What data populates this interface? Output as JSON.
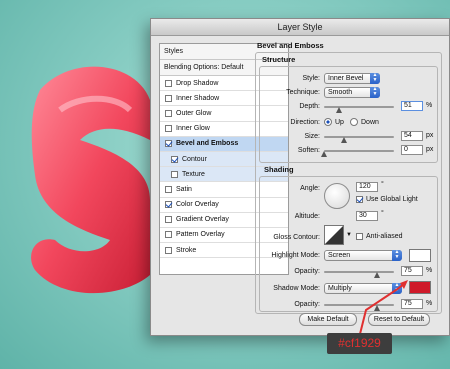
{
  "window": {
    "title": "Layer Style"
  },
  "left_panel": {
    "styles_label": "Styles",
    "blending_label": "Blending Options: Default",
    "items": [
      {
        "label": "Drop Shadow",
        "checked": false
      },
      {
        "label": "Inner Shadow",
        "checked": false
      },
      {
        "label": "Outer Glow",
        "checked": false
      },
      {
        "label": "Inner Glow",
        "checked": false
      },
      {
        "label": "Bevel and Emboss",
        "checked": true
      },
      {
        "label": "Contour",
        "checked": true
      },
      {
        "label": "Texture",
        "checked": false
      },
      {
        "label": "Satin",
        "checked": false
      },
      {
        "label": "Color Overlay",
        "checked": true
      },
      {
        "label": "Gradient Overlay",
        "checked": false
      },
      {
        "label": "Pattern Overlay",
        "checked": false
      },
      {
        "label": "Stroke",
        "checked": false
      }
    ]
  },
  "bevel": {
    "title": "Bevel and Emboss",
    "structure": {
      "title": "Structure",
      "style_label": "Style:",
      "style_value": "Inner Bevel",
      "technique_label": "Technique:",
      "technique_value": "Smooth",
      "depth_label": "Depth:",
      "depth_value": "51",
      "depth_unit": "%",
      "direction_label": "Direction:",
      "dir_up": "Up",
      "dir_down": "Down",
      "size_label": "Size:",
      "size_value": "54",
      "size_unit": "px",
      "soften_label": "Soften:",
      "soften_value": "0",
      "soften_unit": "px"
    },
    "shading": {
      "title": "Shading",
      "angle_label": "Angle:",
      "angle_value": "120",
      "degree": "°",
      "global_light_label": "Use Global Light",
      "altitude_label": "Altitude:",
      "altitude_value": "30",
      "gloss_label": "Gloss Contour:",
      "anti_aliased_label": "Anti-aliased",
      "highlight_label": "Highlight Mode:",
      "highlight_value": "Screen",
      "opacity_label": "Opacity:",
      "highlight_opacity": "75",
      "shadow_label": "Shadow Mode:",
      "shadow_value": "Multiply",
      "shadow_opacity": "75",
      "pct": "%"
    }
  },
  "buttons": {
    "make_default": "Make Default",
    "reset_default": "Reset to Default"
  },
  "colors": {
    "highlight_swatch": "#ffffff",
    "shadow_swatch": "#cf1929",
    "annotation": "#e03030"
  },
  "annotation": {
    "text": "#cf1929"
  }
}
